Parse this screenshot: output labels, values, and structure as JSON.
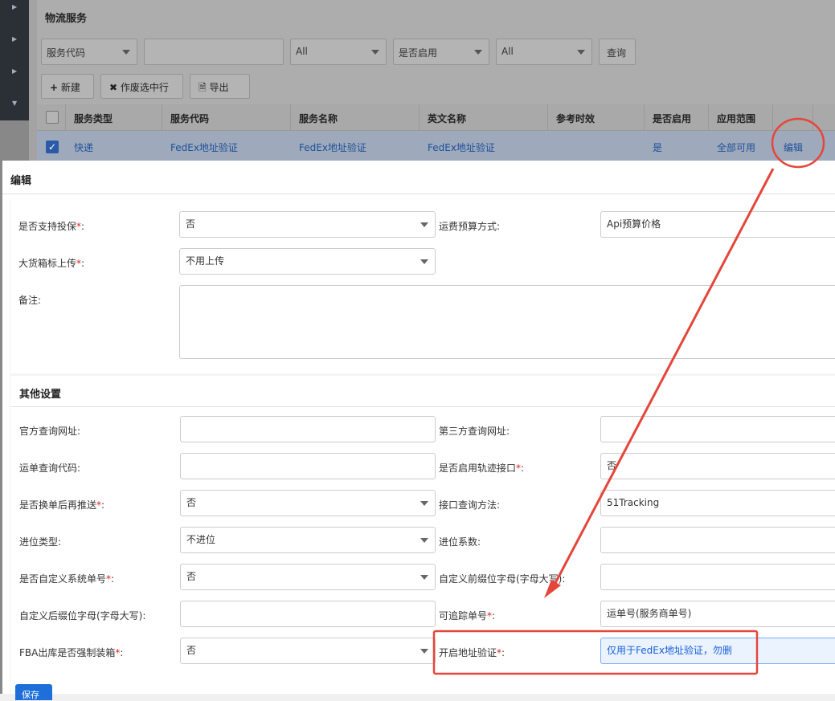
{
  "list_page": {
    "title": "物流服务",
    "filters": [
      {
        "value": "服务代码"
      },
      {
        "value": ""
      },
      {
        "value": "All"
      },
      {
        "value": "是否启用"
      },
      {
        "value": "All"
      }
    ],
    "search_label": "查询",
    "toolbar": {
      "new_label": "新建",
      "void_label": "作废选中行",
      "export_label": "导出"
    },
    "columns": [
      "服务类型",
      "服务代码",
      "服务名称",
      "英文名称",
      "参考时效",
      "是否启用",
      "应用范围"
    ],
    "row": {
      "type": "快递",
      "code": "FedEx地址验证",
      "name": "FedEx地址验证",
      "en_name": "FedEx地址验证",
      "timeliness": "",
      "enabled": "是",
      "scope": "全部可用",
      "edit_label": "编辑"
    }
  },
  "modal": {
    "title": "编辑",
    "basic": {
      "insurance": {
        "label": "是否支持投保",
        "value": "否"
      },
      "freight_budget": {
        "label": "运费预算方式:",
        "value": "Api预算价格"
      },
      "big_box_label": {
        "label": "大货箱标上传",
        "value": "不用上传"
      },
      "remark": {
        "label": "备注:"
      }
    },
    "other_section_title": "其他设置",
    "other": {
      "official_url": {
        "label": "官方查询网址:",
        "value": ""
      },
      "third_party_url": {
        "label": "第三方查询网址:",
        "value": ""
      },
      "waybill_code": {
        "label": "运单查询代码:",
        "value": ""
      },
      "track_api_enabled": {
        "label": "是否启用轨迹接口",
        "value": "否"
      },
      "push_after_change": {
        "label": "是否换单后再推送",
        "value": "否"
      },
      "api_query_method": {
        "label": "接口查询方法:",
        "value": "51Tracking"
      },
      "carry_type": {
        "label": "进位类型:",
        "value": "不进位"
      },
      "carry_factor": {
        "label": "进位系数:",
        "value": ""
      },
      "custom_system_no": {
        "label": "是否自定义系统单号",
        "value": "否"
      },
      "custom_prefix": {
        "label": "自定义前缀位字母(字母大写):",
        "value": ""
      },
      "custom_suffix": {
        "label": "自定义后缀位字母(字母大写):",
        "value": ""
      },
      "trackable_no": {
        "label": "可追踪单号",
        "value": "运单号(服务商单号)"
      },
      "fba_force_boxing": {
        "label": "FBA出库是否强制装箱",
        "value": "否"
      },
      "address_verify": {
        "label": "开启地址验证",
        "value": "仅用于FedEx地址验证，勿删"
      }
    },
    "save_label": "保存"
  },
  "colors": {
    "accent": "#1e6fd9",
    "required": "#e02020",
    "annotation": "#e5463b"
  }
}
